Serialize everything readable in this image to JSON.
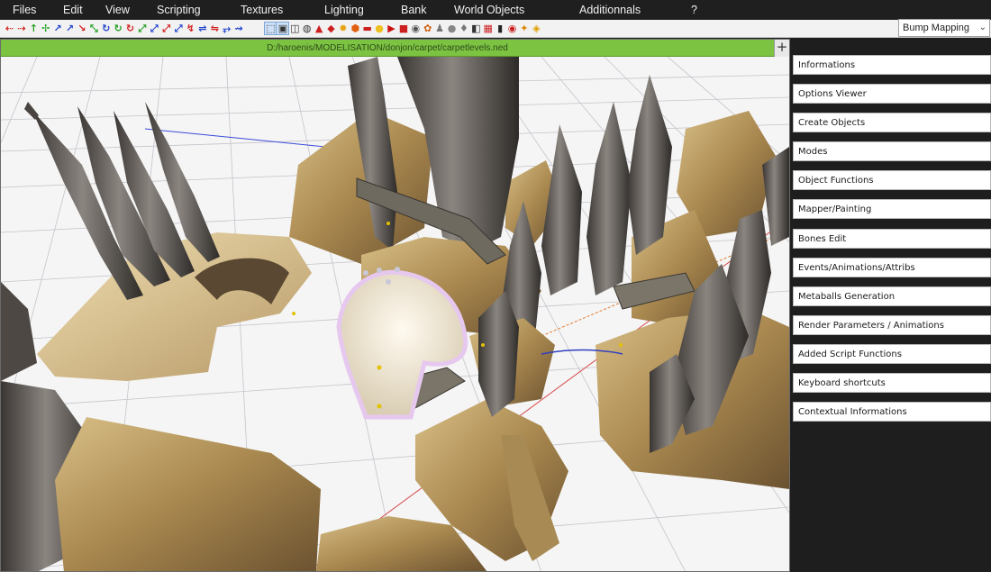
{
  "menu": [
    {
      "id": "files",
      "label": "Files"
    },
    {
      "id": "edit",
      "label": "Edit"
    },
    {
      "id": "view",
      "label": "View"
    },
    {
      "id": "scripting",
      "label": "Scripting"
    },
    {
      "id": "textures",
      "label": "Textures"
    },
    {
      "id": "lighting",
      "label": "Lighting"
    },
    {
      "id": "bank",
      "label": "Bank"
    },
    {
      "id": "world_objects",
      "label": "World Objects"
    },
    {
      "id": "additionnals",
      "label": "Additionnals"
    },
    {
      "id": "help",
      "label": "?"
    }
  ],
  "toolbar": {
    "buttons": [
      {
        "icon": "arrow-left-icon",
        "glyph": "⇠",
        "color": "#d22020"
      },
      {
        "icon": "arrow-right-icon",
        "glyph": "⇢",
        "color": "#d22020"
      },
      {
        "icon": "move-y-icon",
        "glyph": "↑",
        "color": "#22a020"
      },
      {
        "icon": "move-xy-icon",
        "glyph": "✢",
        "color": "#22a020"
      },
      {
        "icon": "move-diag-icon",
        "glyph": "↗",
        "color": "#2244cc"
      },
      {
        "icon": "move-diag-2-icon",
        "glyph": "↗",
        "color": "#2244cc"
      },
      {
        "icon": "move-z-icon",
        "glyph": "↘",
        "color": "#d22020"
      },
      {
        "icon": "move-yz-icon",
        "glyph": "⤡",
        "color": "#22a020"
      },
      {
        "icon": "rotate-x-icon",
        "glyph": "↻",
        "color": "#2244cc"
      },
      {
        "icon": "rotate-y-icon",
        "glyph": "↻",
        "color": "#22a020"
      },
      {
        "icon": "rotate-z-icon",
        "glyph": "↻",
        "color": "#d22020"
      },
      {
        "icon": "scale-icon",
        "glyph": "⤢",
        "color": "#22a020"
      },
      {
        "icon": "scale-x-icon",
        "glyph": "⤢",
        "color": "#2244cc"
      },
      {
        "icon": "scale-y-icon",
        "glyph": "⤢",
        "color": "#d22020"
      },
      {
        "icon": "scale-z-icon",
        "glyph": "⤢",
        "color": "#2244cc"
      },
      {
        "icon": "snap-icon",
        "glyph": "↯",
        "color": "#d22020"
      },
      {
        "icon": "mirror-icon",
        "glyph": "⇌",
        "color": "#2244cc"
      },
      {
        "icon": "align-icon",
        "glyph": "⇋",
        "color": "#d22020"
      },
      {
        "icon": "weld-icon",
        "glyph": "⥅",
        "color": "#2244cc"
      },
      {
        "icon": "extrude-icon",
        "glyph": "⇝",
        "color": "#2244cc"
      },
      {
        "icon": "object-select-icon",
        "glyph": "⬚",
        "color": "#333333",
        "active": true
      },
      {
        "icon": "face-select-icon",
        "glyph": "▣",
        "color": "#333333",
        "active": true
      },
      {
        "icon": "cube-icon",
        "glyph": "◫",
        "color": "#333333"
      },
      {
        "icon": "cylinder-icon",
        "glyph": "◍",
        "color": "#333333"
      },
      {
        "icon": "cone-icon",
        "glyph": "▲",
        "color": "#cc2020"
      },
      {
        "icon": "diamond-icon",
        "glyph": "◆",
        "color": "#cc2020"
      },
      {
        "icon": "light-icon",
        "glyph": "✹",
        "color": "#e8a010"
      },
      {
        "icon": "shape-icon",
        "glyph": "⬢",
        "color": "#e06010"
      },
      {
        "icon": "plane-icon",
        "glyph": "▬",
        "color": "#cc2020"
      },
      {
        "icon": "bulb-icon",
        "glyph": "●",
        "color": "#f0c020"
      },
      {
        "icon": "play-icon",
        "glyph": "▶",
        "color": "#cc1010"
      },
      {
        "icon": "record-icon",
        "glyph": "■",
        "color": "#cc2020"
      },
      {
        "icon": "camera-icon",
        "glyph": "◉",
        "color": "#555555"
      },
      {
        "icon": "palette-icon",
        "glyph": "✿",
        "color": "#d06010"
      },
      {
        "icon": "bone-icon",
        "glyph": "♟",
        "color": "#777777"
      },
      {
        "icon": "metaball-icon",
        "glyph": "●",
        "color": "#888888"
      },
      {
        "icon": "morph-icon",
        "glyph": "♦",
        "color": "#777777"
      },
      {
        "icon": "script-icon",
        "glyph": "◧",
        "color": "#333333"
      },
      {
        "icon": "texture-icon",
        "glyph": "▦",
        "color": "#cc2020"
      },
      {
        "icon": "render-icon",
        "glyph": "▮",
        "color": "#222222"
      },
      {
        "icon": "stop-icon",
        "glyph": "◉",
        "color": "#cc2020"
      },
      {
        "icon": "settings-icon",
        "glyph": "✦",
        "color": "#dd8800"
      },
      {
        "icon": "star-icon",
        "glyph": "◈",
        "color": "#e0a000"
      }
    ]
  },
  "render_mode": {
    "selected": "Bump Mapping"
  },
  "viewport": {
    "path": "D:/haroenis/MODELISATION/donjon/carpet/carpetlevels.ned",
    "plus_label": "+"
  },
  "panel": {
    "items": [
      {
        "name": "panel-informations",
        "label": "Informations"
      },
      {
        "name": "panel-options-viewer",
        "label": "Options Viewer"
      },
      {
        "name": "panel-create-objects",
        "label": "Create Objects"
      },
      {
        "name": "panel-modes",
        "label": "Modes"
      },
      {
        "name": "panel-object-functions",
        "label": "Object Functions"
      },
      {
        "name": "panel-mapper-painting",
        "label": "Mapper/Painting"
      },
      {
        "name": "panel-bones-edit",
        "label": "Bones Edit"
      },
      {
        "name": "panel-events-animations",
        "label": "Events/Animations/Attribs"
      },
      {
        "name": "panel-metaballs",
        "label": "Metaballs Generation"
      },
      {
        "name": "panel-render-parameters",
        "label": "Render Parameters / Animations"
      },
      {
        "name": "panel-added-script",
        "label": "Added Script Functions"
      },
      {
        "name": "panel-keyboard-shortcuts",
        "label": "Keyboard shortcuts"
      },
      {
        "name": "panel-contextual-informations",
        "label": "Contextual Informations"
      }
    ]
  },
  "colors": {
    "accent": "#7cc342",
    "menubar": "#1f1f1f",
    "panel_bg": "#1e1e1e"
  }
}
